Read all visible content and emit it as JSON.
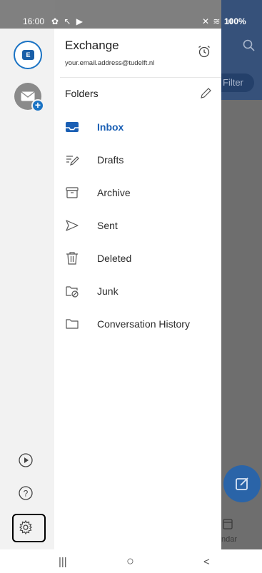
{
  "status_bar": {
    "time": "16:00",
    "notif_icons": "✿ ↖ ▶",
    "right_icons": "✕ ≋ .ıl",
    "battery": "100%"
  },
  "background_app": {
    "filter_label": "Filter",
    "calendar_label": "ndar"
  },
  "account": {
    "name": "Exchange",
    "email": "your.email.address@tudelft.nl"
  },
  "drawer": {
    "folders_heading": "Folders",
    "folders": [
      {
        "label": "Inbox",
        "icon": "inbox-icon",
        "active": true
      },
      {
        "label": "Drafts",
        "icon": "drafts-icon",
        "active": false
      },
      {
        "label": "Archive",
        "icon": "archive-icon",
        "active": false
      },
      {
        "label": "Sent",
        "icon": "sent-icon",
        "active": false
      },
      {
        "label": "Deleted",
        "icon": "trash-icon",
        "active": false
      },
      {
        "label": "Junk",
        "icon": "junk-icon",
        "active": false
      },
      {
        "label": "Conversation History",
        "icon": "folder-icon",
        "active": false
      }
    ]
  },
  "colors": {
    "accent": "#1a5fb4",
    "backdrop": "#6e6e6e",
    "rail": "#f2f2f2"
  },
  "nav": {
    "recents": "|||",
    "home": "○",
    "back": "<"
  }
}
